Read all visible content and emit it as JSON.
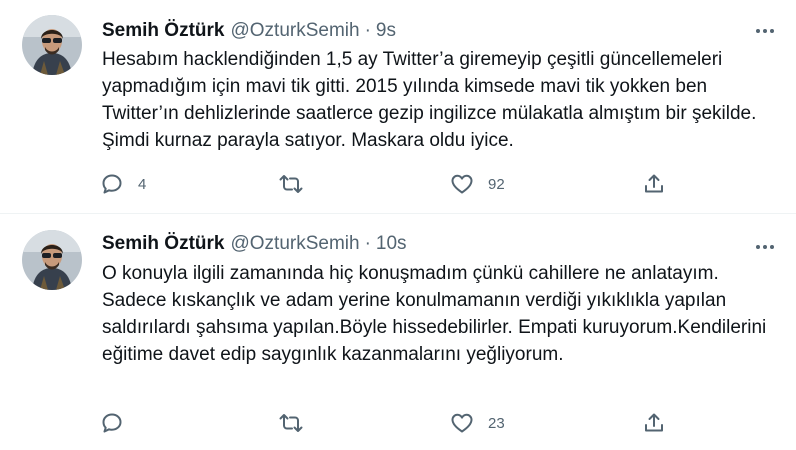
{
  "tweets": [
    {
      "author": {
        "display_name": "Semih Öztürk",
        "handle": "@OzturkSemih"
      },
      "separator": "·",
      "time": "9s",
      "text": "Hesabım hacklendiğinden 1,5 ay Twitter’a giremeyip çeşitli güncellemeleri yapmadığım için mavi tik gitti. 2015 yılında kimsede mavi tik yokken ben Twitter’ın dehlizlerinde saatlerce gezip ingilizce mülakatla almıştım bir şekilde. Şimdi kurnaz parayla satıyor. Maskara oldu iyice.",
      "replies": "4",
      "retweets": "",
      "likes": "92"
    },
    {
      "author": {
        "display_name": "Semih Öztürk",
        "handle": "@OzturkSemih"
      },
      "separator": "·",
      "time": "10s",
      "text": "O konuyla ilgili zamanında hiç konuşmadım çünkü cahillere ne anlatayım. Sadece kıskançlık ve adam yerine konulmamanın verdiği yıkıklıkla yapılan saldırılardı şahsıma yapılan.Böyle hissedebilirler. Empati kuruyorum.Kendilerini eğitime davet edip saygınlık kazanmalarını yeğliyorum.",
      "replies": "",
      "retweets": "",
      "likes": "23"
    }
  ],
  "icons": {
    "reply": "reply-icon",
    "retweet": "retweet-icon",
    "like": "heart-icon",
    "share": "share-icon",
    "more": "more-icon"
  },
  "colors": {
    "text": "#0f1419",
    "secondary": "#536471",
    "divider": "#eff3f4"
  }
}
